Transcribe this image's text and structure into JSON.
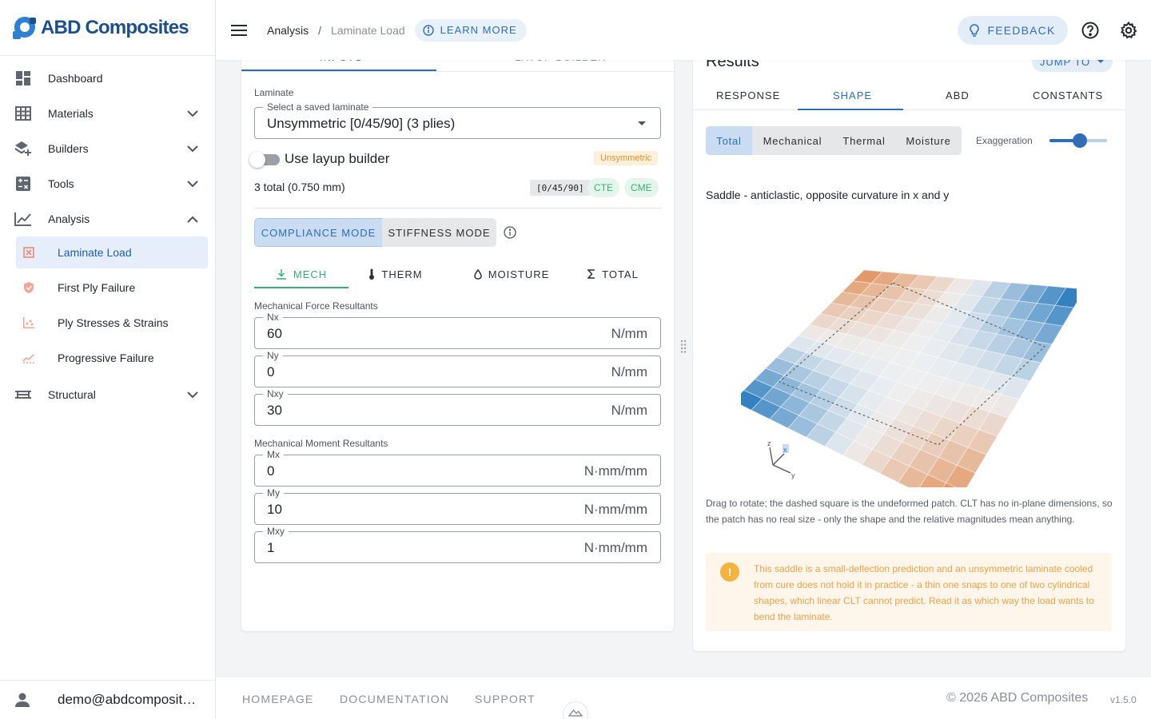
{
  "app": {
    "name": "ABD Composites",
    "brand_color": "#1e4f8a",
    "accent": "#2f6db5"
  },
  "sidebar": {
    "items": [
      {
        "label": "Dashboard",
        "icon": "dashboard-icon"
      },
      {
        "label": "Materials",
        "icon": "grid-table-icon"
      },
      {
        "label": "Builders",
        "icon": "layers-plus-icon"
      },
      {
        "label": "Tools",
        "icon": "calculator-icon"
      },
      {
        "label": "Analysis",
        "icon": "line-chart-icon"
      },
      {
        "label": "Structural",
        "icon": "beam-icon"
      }
    ],
    "analysis_children": [
      {
        "label": "Laminate Load",
        "icon": "load-grid-icon",
        "active": true
      },
      {
        "label": "First Ply Failure",
        "icon": "shield-icon"
      },
      {
        "label": "Ply Stresses & Strains",
        "icon": "scatter-icon"
      },
      {
        "label": "Progressive Failure",
        "icon": "trend-icon"
      }
    ],
    "user": "demo@abdcomposit…"
  },
  "topbar": {
    "breadcrumb_root": "Analysis",
    "breadcrumb_sep": "/",
    "breadcrumb_current": "Laminate Load",
    "learn_more": "LEARN MORE",
    "feedback": "FEEDBACK"
  },
  "inputs": {
    "tabs": [
      "INPUTS",
      "LAYUP BUILDER"
    ],
    "laminate_label": "Laminate",
    "select_legend": "Select a saved laminate",
    "select_value": "Unsymmetric [0/45/90] (3 plies)",
    "use_layup_builder": "Use layup builder",
    "badge_unsym": "Unsymmetric",
    "total_text": "3 total (0.750 mm)",
    "chip_code": "[0/45/90]",
    "chip_cte": "CTE",
    "chip_cme": "CME",
    "mode_compliance": "COMPLIANCE MODE",
    "mode_stiffness": "STIFFNESS MODE",
    "load_tabs": {
      "mech": "MECH",
      "therm": "THERM",
      "moisture": "MOISTURE",
      "total": "TOTAL"
    },
    "force_label": "Mechanical Force Resultants",
    "moment_label": "Mechanical Moment Resultants",
    "forces": [
      {
        "name": "Nx",
        "value": "60",
        "unit": "N/mm"
      },
      {
        "name": "Ny",
        "value": "0",
        "unit": "N/mm"
      },
      {
        "name": "Nxy",
        "value": "30",
        "unit": "N/mm"
      }
    ],
    "moments": [
      {
        "name": "Mx",
        "value": "0",
        "unit": "N·mm/mm"
      },
      {
        "name": "My",
        "value": "10",
        "unit": "N·mm/mm"
      },
      {
        "name": "Mxy",
        "value": "1",
        "unit": "N·mm/mm"
      }
    ]
  },
  "results": {
    "title": "Results",
    "jump_to": "JUMP TO",
    "tabs": [
      "RESPONSE",
      "SHAPE",
      "ABD",
      "CONSTANTS"
    ],
    "segments": [
      "Total",
      "Mechanical",
      "Thermal",
      "Moisture"
    ],
    "exaggeration_label": "Exaggeration",
    "exaggeration_level": 0.53,
    "shape_desc": "Saddle - anticlastic, opposite curvature in x and y",
    "axes": {
      "z": "z",
      "x": "x",
      "y": "y"
    },
    "caption": "Drag to rotate; the dashed square is the undeformed patch. CLT has no in-plane dimensions, so the patch has no real size - only the shape and the relative magnitudes mean anything.",
    "warning_icon": "!",
    "warning": "This saddle is a small-deflection prediction and an unsymmetric laminate cooled from cure does not hold it in practice - a thin one snaps to one of two cylindrical shapes, which linear CLT cannot predict. Read it as which way the load wants to bend the laminate."
  },
  "footer": {
    "links": [
      "HOMEPAGE",
      "DOCUMENTATION",
      "SUPPORT"
    ],
    "copyright": "© 2026 ABD Composites",
    "version": "v1.5.0"
  }
}
